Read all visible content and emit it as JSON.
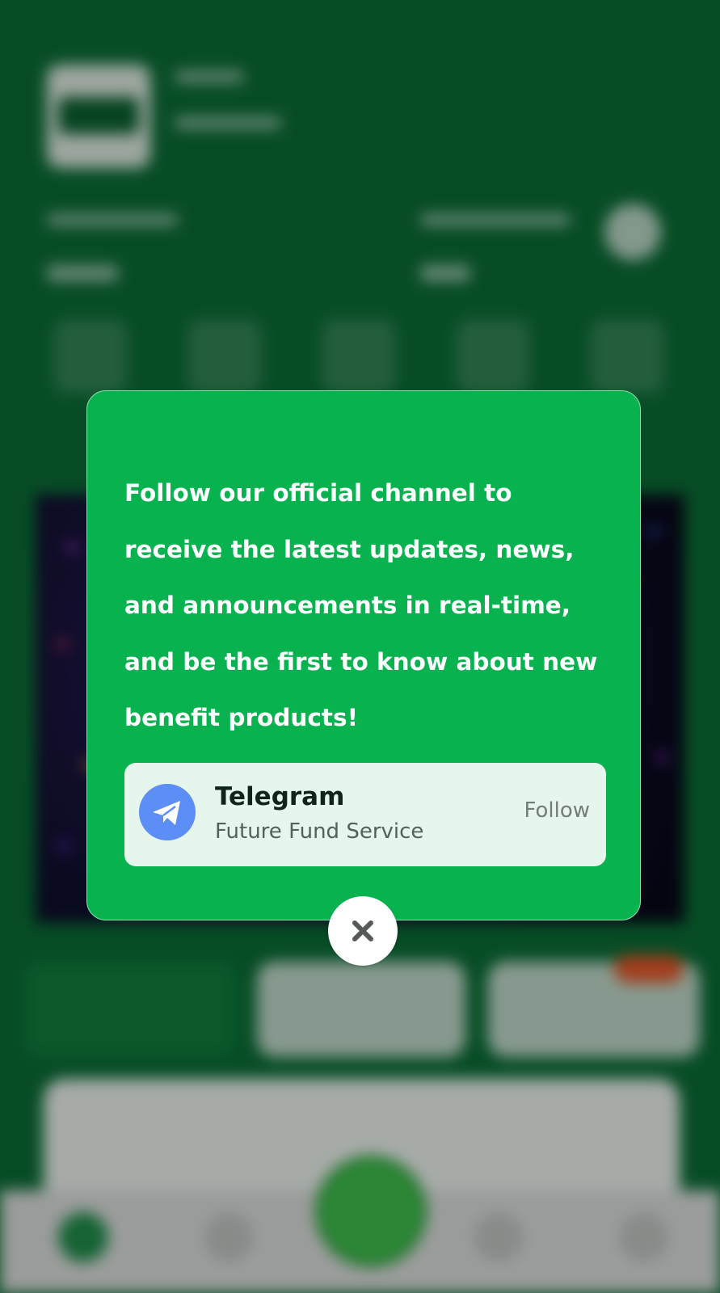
{
  "modal": {
    "message": "Follow our official channel to receive the latest updates, news, and announcements in real-time, and be the first to know about new benefit products!",
    "channel": {
      "title": "Telegram",
      "subtitle": "Future Fund Service",
      "follow_label": "Follow",
      "icon": "telegram-icon"
    },
    "close_icon": "close-icon"
  },
  "colors": {
    "modal_bg": "#07b24f",
    "card_bg": "#e6f6ec",
    "telegram_blue": "#5c8ef5",
    "app_green": "#0a6a34"
  }
}
